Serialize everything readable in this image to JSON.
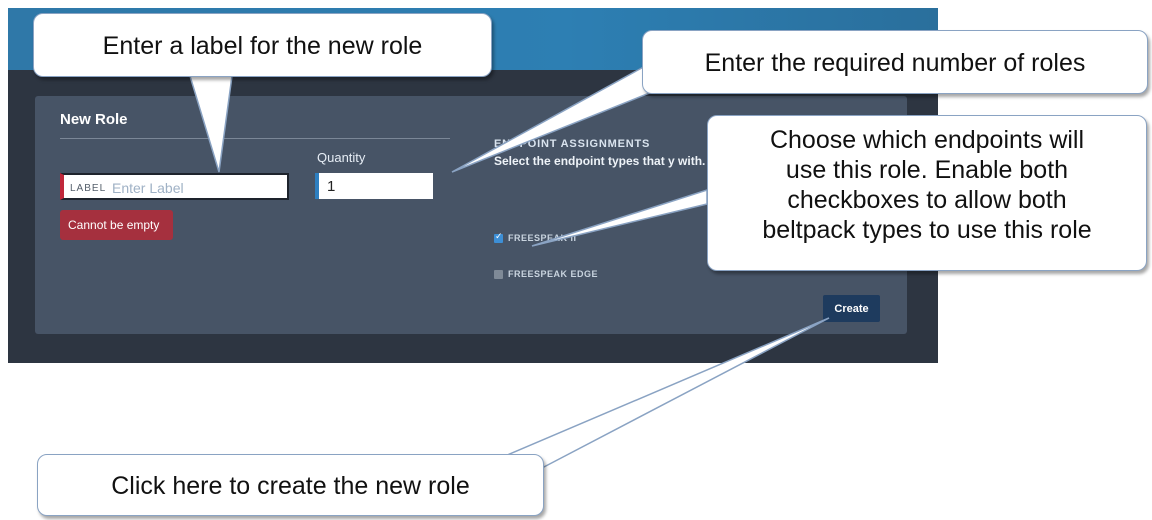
{
  "app": {
    "panel": {
      "title": "New Role",
      "label_field": {
        "tag": "LABEL",
        "placeholder": "Enter Label",
        "value": ""
      },
      "error": "Cannot be empty",
      "quantity": {
        "label": "Quantity",
        "value": "1"
      },
      "endpoints": {
        "heading": "ENDPOINT ASSIGNMENTS",
        "description": "Select the endpoint types that y with.",
        "options": [
          {
            "label": "FREESPEAK II",
            "checked": true
          },
          {
            "label": "FREESPEAK EDGE",
            "checked": false
          }
        ]
      },
      "create_button": "Create"
    }
  },
  "callouts": {
    "label": "Enter a label for the new role",
    "quantity": "Enter the required number of roles",
    "endpoints": [
      "Choose which endpoints will",
      "use this role. Enable both",
      "checkboxes to allow both",
      "beltpack types to use this role"
    ],
    "create": "Click here to create the new role"
  },
  "colors": {
    "background": "#2d3541",
    "panel": "#475466",
    "error": "#a5303e",
    "accent": "#3d8fd6",
    "button": "#1e3b5e"
  }
}
